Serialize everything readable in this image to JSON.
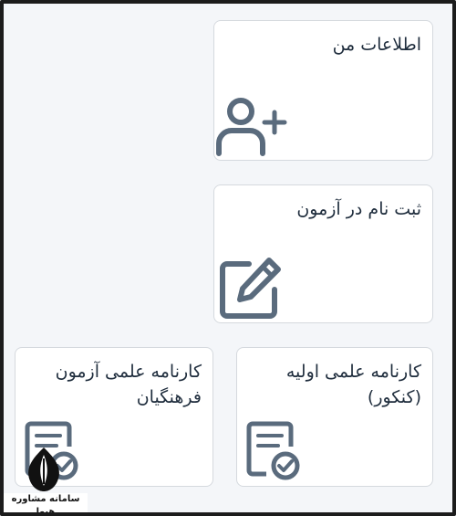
{
  "cards": {
    "profile": {
      "title": "اطلاعات من",
      "icon": "user-plus-icon"
    },
    "register": {
      "title": "ثبت نام در آزمون",
      "icon": "edit-square-icon"
    },
    "konkur": {
      "title": "کارنامه علمی اولیه\n(کنکور)",
      "icon": "certificate-check-icon"
    },
    "farhangian": {
      "title": "کارنامه علمی آزمون\nفرهنگیان",
      "icon": "certificate-check-icon"
    }
  },
  "colors": {
    "icon": "#5a6b7d",
    "title": "#1f2d3d",
    "background": "#f4f6f9"
  },
  "watermark": {
    "text": "سامانه مشاوره هیوا"
  }
}
